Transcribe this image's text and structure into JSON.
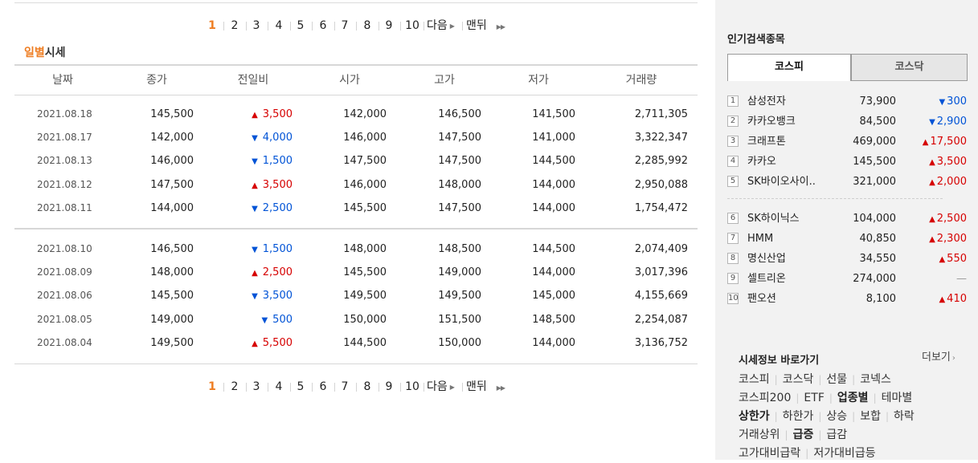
{
  "pagination": {
    "pages": [
      "1",
      "2",
      "3",
      "4",
      "5",
      "6",
      "7",
      "8",
      "9",
      "10"
    ],
    "current": "1",
    "next_label": "다음",
    "last_label": "맨뒤"
  },
  "section": {
    "title_highlight": "일별",
    "title_rest": "시세"
  },
  "table": {
    "headers": [
      "날짜",
      "종가",
      "전일비",
      "시가",
      "고가",
      "저가",
      "거래량"
    ],
    "rows": [
      {
        "date": "2021.08.18",
        "close": "145,500",
        "dir": "up",
        "change": "3,500",
        "open": "142,000",
        "high": "146,500",
        "low": "141,500",
        "volume": "2,711,305"
      },
      {
        "date": "2021.08.17",
        "close": "142,000",
        "dir": "down",
        "change": "4,000",
        "open": "146,000",
        "high": "147,500",
        "low": "141,000",
        "volume": "3,322,347"
      },
      {
        "date": "2021.08.13",
        "close": "146,000",
        "dir": "down",
        "change": "1,500",
        "open": "147,500",
        "high": "147,500",
        "low": "144,500",
        "volume": "2,285,992"
      },
      {
        "date": "2021.08.12",
        "close": "147,500",
        "dir": "up",
        "change": "3,500",
        "open": "146,000",
        "high": "148,000",
        "low": "144,000",
        "volume": "2,950,088"
      },
      {
        "date": "2021.08.11",
        "close": "144,000",
        "dir": "down",
        "change": "2,500",
        "open": "145,500",
        "high": "147,500",
        "low": "144,000",
        "volume": "1,754,472"
      },
      {
        "date": "2021.08.10",
        "close": "146,500",
        "dir": "down",
        "change": "1,500",
        "open": "148,000",
        "high": "148,500",
        "low": "144,500",
        "volume": "2,074,409"
      },
      {
        "date": "2021.08.09",
        "close": "148,000",
        "dir": "up",
        "change": "2,500",
        "open": "145,500",
        "high": "149,000",
        "low": "144,000",
        "volume": "3,017,396"
      },
      {
        "date": "2021.08.06",
        "close": "145,500",
        "dir": "down",
        "change": "3,500",
        "open": "149,500",
        "high": "149,500",
        "low": "145,000",
        "volume": "4,155,669"
      },
      {
        "date": "2021.08.05",
        "close": "149,000",
        "dir": "down",
        "change": "500",
        "open": "150,000",
        "high": "151,500",
        "low": "148,500",
        "volume": "2,254,087"
      },
      {
        "date": "2021.08.04",
        "close": "149,500",
        "dir": "up",
        "change": "5,500",
        "open": "144,500",
        "high": "150,000",
        "low": "144,000",
        "volume": "3,136,752"
      }
    ]
  },
  "sidebar": {
    "popular_title": "인기검색종목",
    "tabs": [
      "코스피",
      "코스닥"
    ],
    "popular": [
      {
        "rank": "1",
        "name": "삼성전자",
        "price": "73,900",
        "dir": "down",
        "change": "300"
      },
      {
        "rank": "2",
        "name": "카카오뱅크",
        "price": "84,500",
        "dir": "down",
        "change": "2,900"
      },
      {
        "rank": "3",
        "name": "크래프톤",
        "price": "469,000",
        "dir": "up",
        "change": "17,500"
      },
      {
        "rank": "4",
        "name": "카카오",
        "price": "145,500",
        "dir": "up",
        "change": "3,500"
      },
      {
        "rank": "5",
        "name": "SK바이오사이..",
        "price": "321,000",
        "dir": "up",
        "change": "2,000"
      },
      {
        "rank": "6",
        "name": "SK하이닉스",
        "price": "104,000",
        "dir": "up",
        "change": "2,500"
      },
      {
        "rank": "7",
        "name": "HMM",
        "price": "40,850",
        "dir": "up",
        "change": "2,300"
      },
      {
        "rank": "8",
        "name": "명신산업",
        "price": "34,550",
        "dir": "up",
        "change": "550"
      },
      {
        "rank": "9",
        "name": "셀트리온",
        "price": "274,000",
        "dir": "flat",
        "change": ""
      },
      {
        "rank": "10",
        "name": "팬오션",
        "price": "8,100",
        "dir": "up",
        "change": "410"
      }
    ],
    "quick_title": "시세정보 바로가기",
    "quick_more": "더보기",
    "quick_links": [
      [
        {
          "t": "코스피"
        },
        {
          "t": "코스닥"
        },
        {
          "t": "선물"
        },
        {
          "t": "코넥스"
        }
      ],
      [
        {
          "t": "코스피200"
        },
        {
          "t": "ETF"
        },
        {
          "t": "업종별",
          "bold": true
        },
        {
          "t": "테마별"
        }
      ],
      [
        {
          "t": "상한가",
          "bold": true
        },
        {
          "t": "하한가"
        },
        {
          "t": "상승"
        },
        {
          "t": "보합"
        },
        {
          "t": "하락"
        }
      ],
      [
        {
          "t": "거래상위"
        },
        {
          "t": "급증",
          "bold": true
        },
        {
          "t": "급감"
        }
      ],
      [
        {
          "t": "고가대비급락"
        },
        {
          "t": "저가대비급등"
        }
      ]
    ]
  },
  "colors": {
    "accent": "#ee7d22",
    "up": "#d60000",
    "down": "#0053d6"
  },
  "icons": {
    "up": "triangle-up-icon",
    "down": "triangle-down-icon",
    "next": "triangle-right-icon",
    "last": "double-triangle-right-icon",
    "more": "chevron-right-icon"
  }
}
